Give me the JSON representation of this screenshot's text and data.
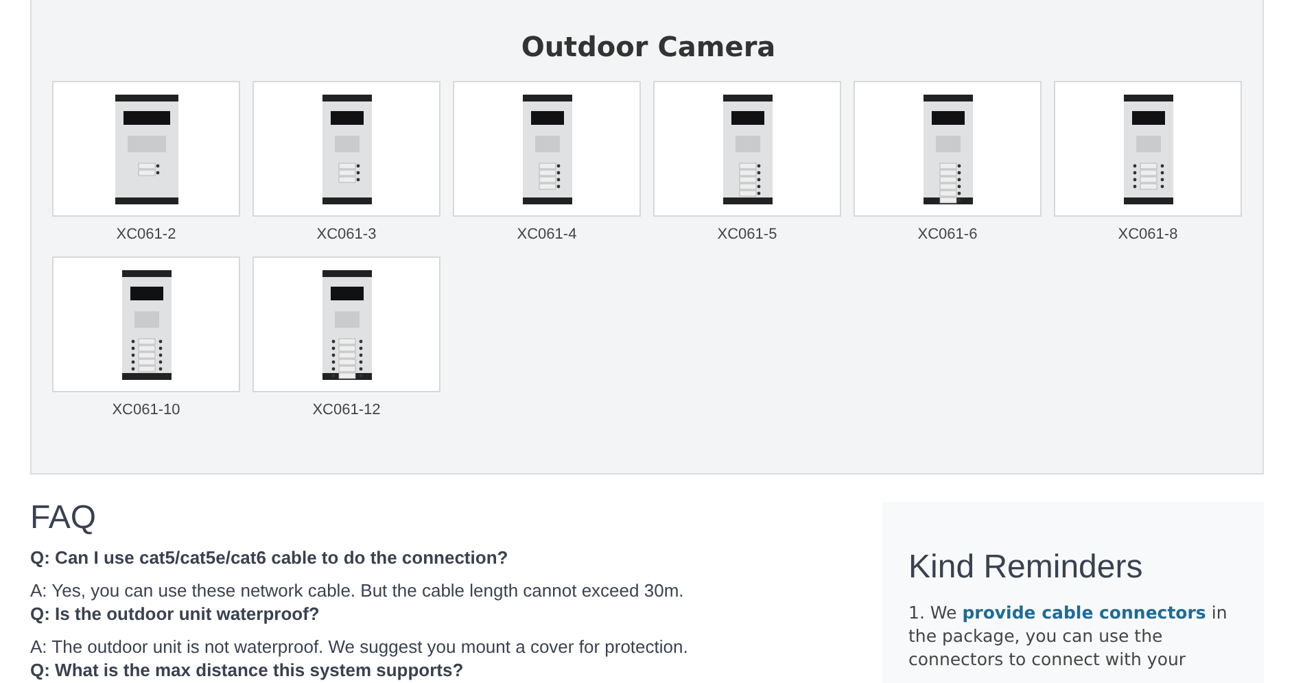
{
  "outdoor_camera": {
    "title": "Outdoor Camera",
    "products": [
      {
        "model": "XC061-2"
      },
      {
        "model": "XC061-3"
      },
      {
        "model": "XC061-4"
      },
      {
        "model": "XC061-5"
      },
      {
        "model": "XC061-6"
      },
      {
        "model": "XC061-8"
      },
      {
        "model": "XC061-10"
      },
      {
        "model": "XC061-12"
      }
    ]
  },
  "faq": {
    "title": "FAQ",
    "items": [
      {
        "kind": "question",
        "text": "Q: Can I use cat5/cat5e/cat6 cable to do the connection?"
      },
      {
        "kind": "answer",
        "text": "A: Yes, you can use these network cable. But the cable length cannot exceed 30m."
      },
      {
        "kind": "question",
        "text": "Q: Is the outdoor unit waterproof?"
      },
      {
        "kind": "answer",
        "text": "A: The outdoor unit is not waterproof. We suggest you mount a cover for protection."
      },
      {
        "kind": "question",
        "text": "Q: What is the max distance this system supports?"
      }
    ]
  },
  "kind_reminders": {
    "title": "Kind Reminders",
    "text": "1. We **provide cable connectors** in the package, you can use the connectors to connect with your"
  }
}
